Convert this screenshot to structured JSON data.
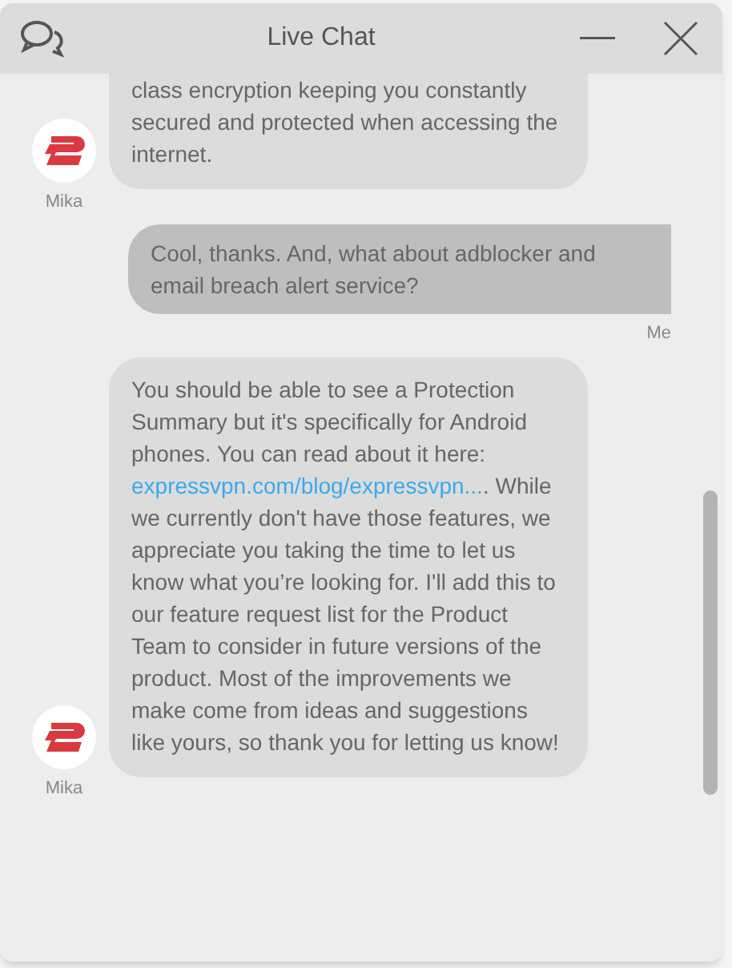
{
  "window": {
    "title": "Live Chat"
  },
  "messages": [
    {
      "kind": "agent",
      "cut": true,
      "author": "Mika",
      "parts": [
        {
          "text": "class encryption keeping you constantly secured and protected when accessing the internet."
        }
      ]
    },
    {
      "kind": "user",
      "cut": false,
      "author": "Me",
      "parts": [
        {
          "text": "Cool, thanks. And, what about adblocker and email breach alert service?"
        }
      ]
    },
    {
      "kind": "agent",
      "cut": false,
      "author": "Mika",
      "parts": [
        {
          "text": "You should be able to see a Protection Summary but it's specifically for Android phones. You can read about it here: "
        },
        {
          "link": "expressvpn.com/blog/expressvpn..."
        },
        {
          "text": ". While we currently don't have those features, we appreciate you taking the time to let us know what you’re looking for. I'll add this to our feature request list for the Product Team to consider in future versions of the product. Most of the improvements we make come from ideas and suggestions like yours, so thank you for letting us know!"
        }
      ]
    }
  ]
}
